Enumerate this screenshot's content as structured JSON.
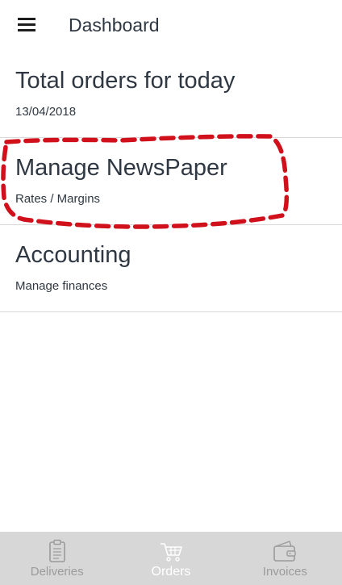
{
  "header": {
    "title": "Dashboard",
    "menu_icon": "hamburger-menu-icon"
  },
  "cards": [
    {
      "title": "Total orders for today",
      "subtitle": "13/04/2018"
    },
    {
      "title": "Manage NewsPaper",
      "subtitle": "Rates / Margins",
      "highlighted": true
    },
    {
      "title": "Accounting",
      "subtitle": "Manage finances"
    }
  ],
  "annotation": {
    "color": "#d0111b",
    "style": "dashed-outline"
  },
  "tabs": [
    {
      "label": "Deliveries",
      "icon": "clipboard-icon",
      "active": false
    },
    {
      "label": "Orders",
      "icon": "cart-icon",
      "active": true
    },
    {
      "label": "Invoices",
      "icon": "wallet-icon",
      "active": false
    }
  ],
  "colors": {
    "text": "#2f3842",
    "tabbar_bg": "#d7d7d7",
    "tab_inactive": "#9b9b9b",
    "tab_active": "#ffffff",
    "divider": "#d9d9d9"
  }
}
